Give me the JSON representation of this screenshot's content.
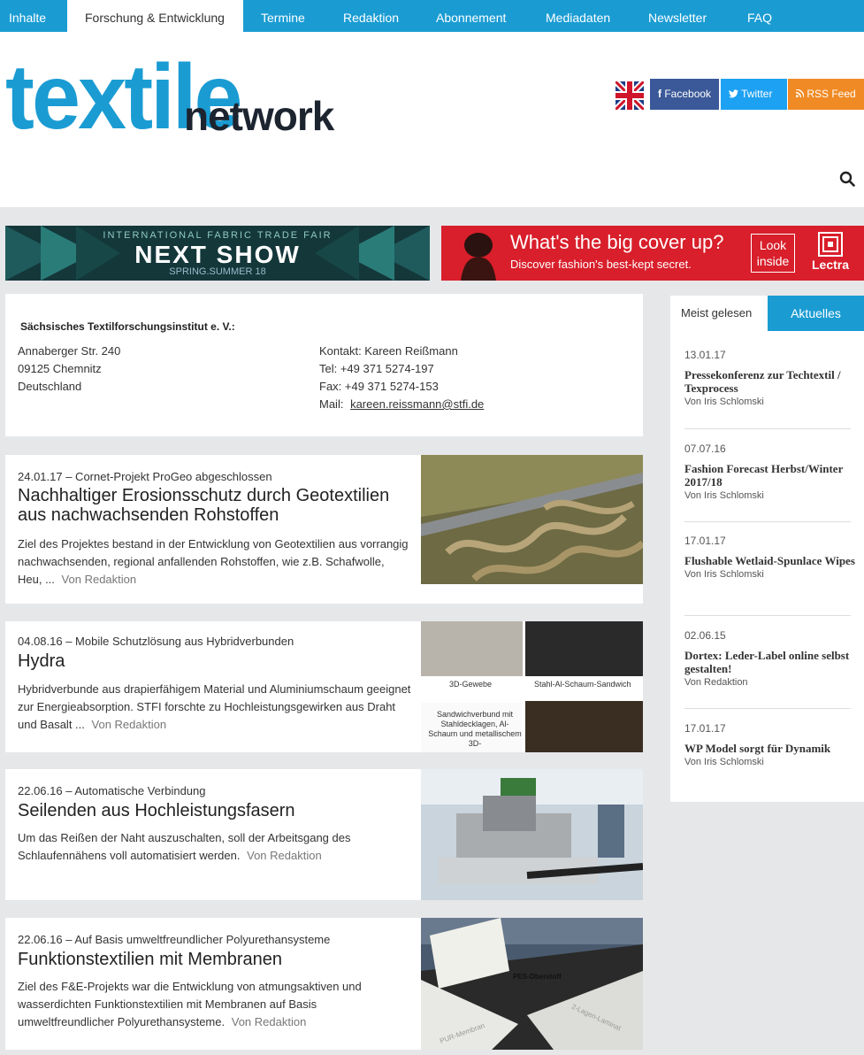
{
  "nav": {
    "items": [
      {
        "label": "Inhalte",
        "active": false
      },
      {
        "label": "Forschung & Entwicklung",
        "active": true
      },
      {
        "label": "Termine",
        "active": false
      },
      {
        "label": "Redaktion",
        "active": false
      },
      {
        "label": "Abonnement",
        "active": false
      },
      {
        "label": "Mediadaten",
        "active": false
      },
      {
        "label": "Newsletter",
        "active": false
      },
      {
        "label": "FAQ",
        "active": false
      }
    ]
  },
  "header": {
    "logo_main": "textile",
    "logo_sub": "network",
    "social": {
      "facebook": "Facebook",
      "twitter": "Twitter",
      "rss": "RSS Feed"
    },
    "colors": {
      "accent": "#1a9cd3",
      "facebook": "#3b5998",
      "twitter": "#1da1f2",
      "rss": "#f08a24"
    }
  },
  "banners": {
    "left": {
      "subtitle": "INTERNATIONAL FABRIC TRADE FAIR",
      "headline": "NEXT SHOW",
      "season": "SPRING.SUMMER 18"
    },
    "right": {
      "headline": "What's the big cover up?",
      "subline": "Discover fashion's best-kept secret.",
      "button_line1": "Look",
      "button_line2": "inside",
      "brand": "Lectra"
    }
  },
  "address": {
    "institute": "Sächsisches Textilforschungsinstitut e. V.:",
    "street": "Annaberger Str. 240",
    "city": "09125 Chemnitz",
    "country": "Deutschland",
    "contact": "Kontakt: Kareen Reißmann",
    "tel": "Tel: +49 371 5274-197",
    "fax": "Fax: +49 371 5274-153",
    "mail_label": "Mail:",
    "mail": "kareen.reissmann@stfi.de"
  },
  "articles": [
    {
      "meta": "24.01.17 – Cornet-Projekt ProGeo abgeschlossen",
      "title": "Nachhaltiger Erosionsschutz durch Geotextilien aus nachwachsenden Rohstoffen",
      "excerpt": "Ziel des Projektes bestand in der Entwicklung von Geotextilien aus vorrangig nachwachsenden, regional anfallenden Rohstoffen, wie z.B. Schafwolle, Heu, ...",
      "author": "Von Redaktion"
    },
    {
      "meta": "04.08.16 – Mobile Schutzlösung aus Hybridverbunden",
      "title": "Hydra",
      "excerpt": "Hybridverbunde aus drapierfähigem Material und Aluminiumschaum geeignet zur Energieabsorption. STFI forschte zu Hochleistungsgewirken aus Draht und Basalt ...",
      "author": "Von Redaktion",
      "image_labels": [
        "3D-Gewebe",
        "Stahl-Al-Schaum-Sandwich",
        "Sandwichverbund mit Stahldecklagen, Al-Schaum und metallischem 3D-"
      ]
    },
    {
      "meta": "22.06.16 – Automatische Verbindung",
      "title": "Seilenden aus Hochleistungsfasern",
      "excerpt": "Um das Reißen der Naht auszuschalten, soll der Arbeitsgang des Schlaufennähens voll automatisiert werden.",
      "author": "Von Redaktion"
    },
    {
      "meta": "22.06.16 – Auf Basis umweltfreundlicher Polyurethansysteme",
      "title": "Funktionstextilien mit Membranen",
      "excerpt": "Ziel des F&E-Projekts war die Entwicklung von atmungsaktiven und wasserdichten Funktionstextilien mit Membranen auf Basis umweltfreundlicher Polyurethansysteme.",
      "author": "Von Redaktion",
      "image_labels": [
        "PES-Oberstoff",
        "PUR-Membran",
        "2-Lagen-Laminat"
      ]
    }
  ],
  "sidebar": {
    "tab_active": "Meist gelesen",
    "tab_other": "Aktuelles",
    "items": [
      {
        "date": "13.01.17",
        "title": "Pressekonferenz zur Techtextil / Texprocess",
        "author": "Von Iris Schlomski"
      },
      {
        "date": "07.07.16",
        "title": "Fashion Forecast Herbst/Winter 2017/18",
        "author": "Von Iris Schlomski"
      },
      {
        "date": "17.01.17",
        "title": "Flushable Wetlaid-Spunlace Wipes",
        "author": "Von Iris Schlomski"
      },
      {
        "date": "02.06.15",
        "title": "Dortex: Leder-Label online selbst gestalten!",
        "author": "Von Redaktion"
      },
      {
        "date": "17.01.17",
        "title": "WP Model sorgt für Dynamik",
        "author": "Von Iris Schlomski"
      }
    ]
  }
}
